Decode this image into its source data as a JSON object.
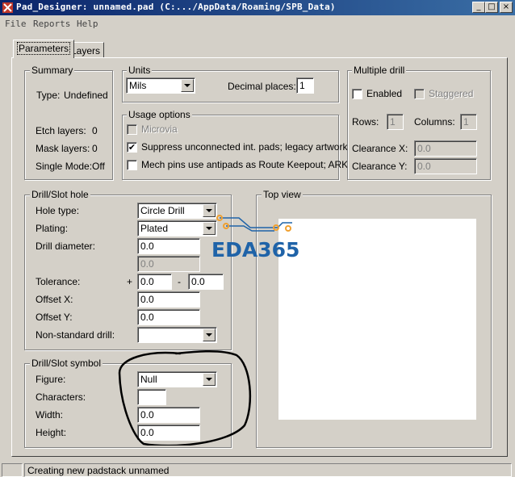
{
  "window": {
    "title": "Pad_Designer: unnamed.pad (C:.../AppData/Roaming/SPB_Data)",
    "minimize_glyph": "_",
    "maximize_glyph": "□",
    "close_glyph": "×",
    "icon": "app-icon"
  },
  "menu": {
    "items": [
      "File",
      "Reports",
      "Help"
    ]
  },
  "tabs": [
    {
      "label": "Parameters",
      "active": true
    },
    {
      "label": "Layers",
      "active": false
    }
  ],
  "summary": {
    "title": "Summary",
    "type_label": "Type:",
    "type_value": "Undefined",
    "etch_label": "Etch layers:",
    "etch_value": "0",
    "mask_label": "Mask layers:",
    "mask_value": "0",
    "single_label": "Single Mode:",
    "single_value": "Off"
  },
  "units": {
    "title": "Units",
    "selected": "Mils",
    "decimal_label": "Decimal places:",
    "decimal_value": "1"
  },
  "usage": {
    "title": "Usage options",
    "microvia_label": "Microvia",
    "suppress_label": "Suppress unconnected int. pads; legacy artwork",
    "suppress_checked": "✔",
    "mech_label": "Mech pins use antipads as Route Keepout; ARK"
  },
  "multiple_drill": {
    "title": "Multiple drill",
    "enabled_label": "Enabled",
    "staggered_label": "Staggered",
    "rows_label": "Rows:",
    "rows_value": "1",
    "columns_label": "Columns:",
    "columns_value": "1",
    "clearance_x_label": "Clearance X:",
    "clearance_x_value": "0.0",
    "clearance_y_label": "Clearance Y:",
    "clearance_y_value": "0.0"
  },
  "drill_hole": {
    "title": "Drill/Slot hole",
    "hole_type_label": "Hole type:",
    "hole_type_value": "Circle Drill",
    "plating_label": "Plating:",
    "plating_value": "Plated",
    "diameter_label": "Drill diameter:",
    "diameter_value": "0.0",
    "diameter2_value": "0.0",
    "tolerance_label": "Tolerance:",
    "tol_plus": "+",
    "tol_plus_value": "0.0",
    "tol_minus": "-",
    "tol_minus_value": "0.0",
    "offset_x_label": "Offset X:",
    "offset_x_value": "0.0",
    "offset_y_label": "Offset Y:",
    "offset_y_value": "0.0",
    "nonstd_label": "Non-standard drill:",
    "nonstd_value": ""
  },
  "drill_symbol": {
    "title": "Drill/Slot symbol",
    "figure_label": "Figure:",
    "figure_value": "Null",
    "characters_label": "Characters:",
    "characters_value": "",
    "width_label": "Width:",
    "width_value": "0.0",
    "height_label": "Height:",
    "height_value": "0.0"
  },
  "top_view": {
    "title": "Top view"
  },
  "watermark": {
    "text": "EDA365",
    "color": "#1f63a8",
    "accent": "#f0a030"
  },
  "status": {
    "message": "Creating new padstack unnamed"
  },
  "colors": {
    "titlebar": "#0a246a",
    "face": "#d4d0c8",
    "annotation": "#000000"
  }
}
